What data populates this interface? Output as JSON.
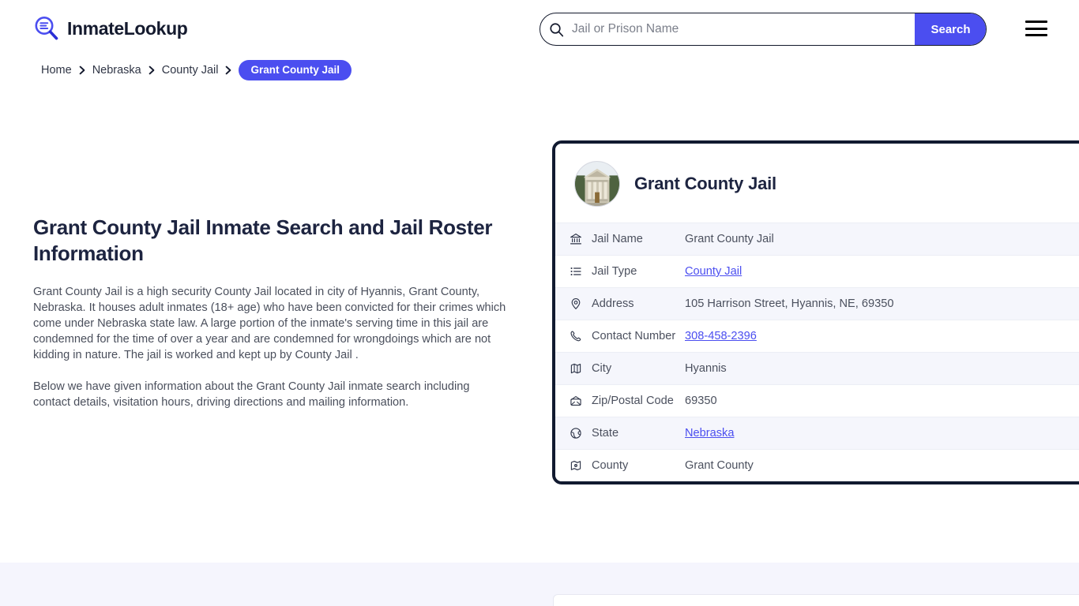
{
  "site": {
    "brand_name": "InmateLookup",
    "brand_icon": "magnifier-list-icon",
    "accent_color": "#4b4ef0",
    "dark_color": "#111a30"
  },
  "header": {
    "search": {
      "placeholder": "Jail or Prison Name",
      "value": "",
      "icon": "search-icon",
      "button_label": "Search"
    },
    "menu_icon": "hamburger-menu-icon"
  },
  "breadcrumb": {
    "separator": "❯",
    "items": [
      {
        "label": "Home",
        "current": false
      },
      {
        "label": "Nebraska",
        "current": false
      },
      {
        "label": "County Jail",
        "current": false
      },
      {
        "label": "Grant County Jail",
        "current": true
      }
    ]
  },
  "main": {
    "title": "Grant County Jail Inmate Search and Jail Roster Information",
    "paragraphs": [
      "Grant County Jail is a high security County Jail located in city of Hyannis, Grant County, Nebraska. It houses adult inmates (18+ age) who have been convicted for their crimes which come under Nebraska state law. A large portion of the inmate's serving time in this jail are condemned for the time of over a year and are condemned for wrongdoings which are not kidding in nature. The jail is worked and kept up by County Jail .",
      "Below we have given information about the Grant County Jail inmate search including contact details, visitation hours, driving directions and mailing information."
    ]
  },
  "info_card": {
    "avatar_alt": "courthouse-photo",
    "title": "Grant County Jail",
    "rows": [
      {
        "icon": "bank-icon",
        "label": "Jail Name",
        "value": "Grant County Jail",
        "link": false,
        "shaded": true
      },
      {
        "icon": "list-icon",
        "label": "Jail Type",
        "value": "County Jail",
        "link": true,
        "shaded": false
      },
      {
        "icon": "map-pin-icon",
        "label": "Address",
        "value": "105 Harrison Street, Hyannis, NE, 69350",
        "link": false,
        "shaded": true
      },
      {
        "icon": "phone-icon",
        "label": "Contact Number",
        "value": "308-458-2396",
        "link": true,
        "shaded": false
      },
      {
        "icon": "map-icon",
        "label": "City",
        "value": "Hyannis",
        "link": false,
        "shaded": true
      },
      {
        "icon": "envelope-icon",
        "label": "Zip/Postal Code",
        "value": "69350",
        "link": false,
        "shaded": false
      },
      {
        "icon": "globe-icon",
        "label": "State",
        "value": "Nebraska",
        "link": true,
        "shaded": true
      },
      {
        "icon": "region-icon",
        "label": "County",
        "value": "Grant County",
        "link": false,
        "shaded": false
      }
    ]
  }
}
